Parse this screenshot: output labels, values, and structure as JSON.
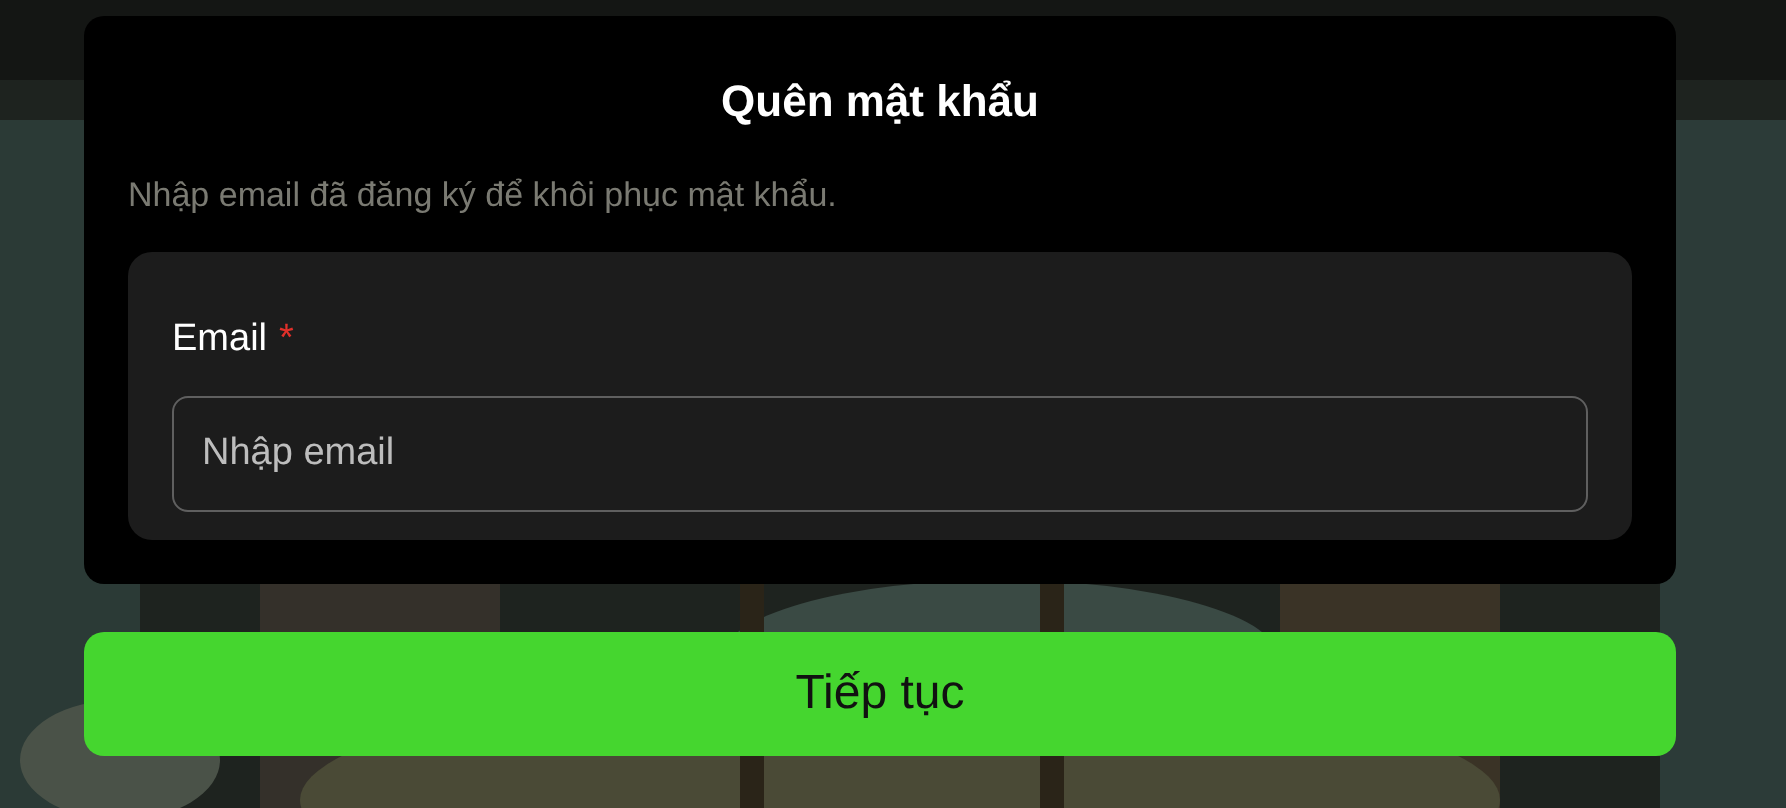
{
  "dialog": {
    "title": "Quên mật khẩu",
    "description": "Nhập email đã đăng ký để khôi phục mật khẩu."
  },
  "form": {
    "label": "Email",
    "required_mark": "*",
    "placeholder": "Nhập email"
  },
  "submit_button": {
    "label": "Tiếp tục"
  }
}
